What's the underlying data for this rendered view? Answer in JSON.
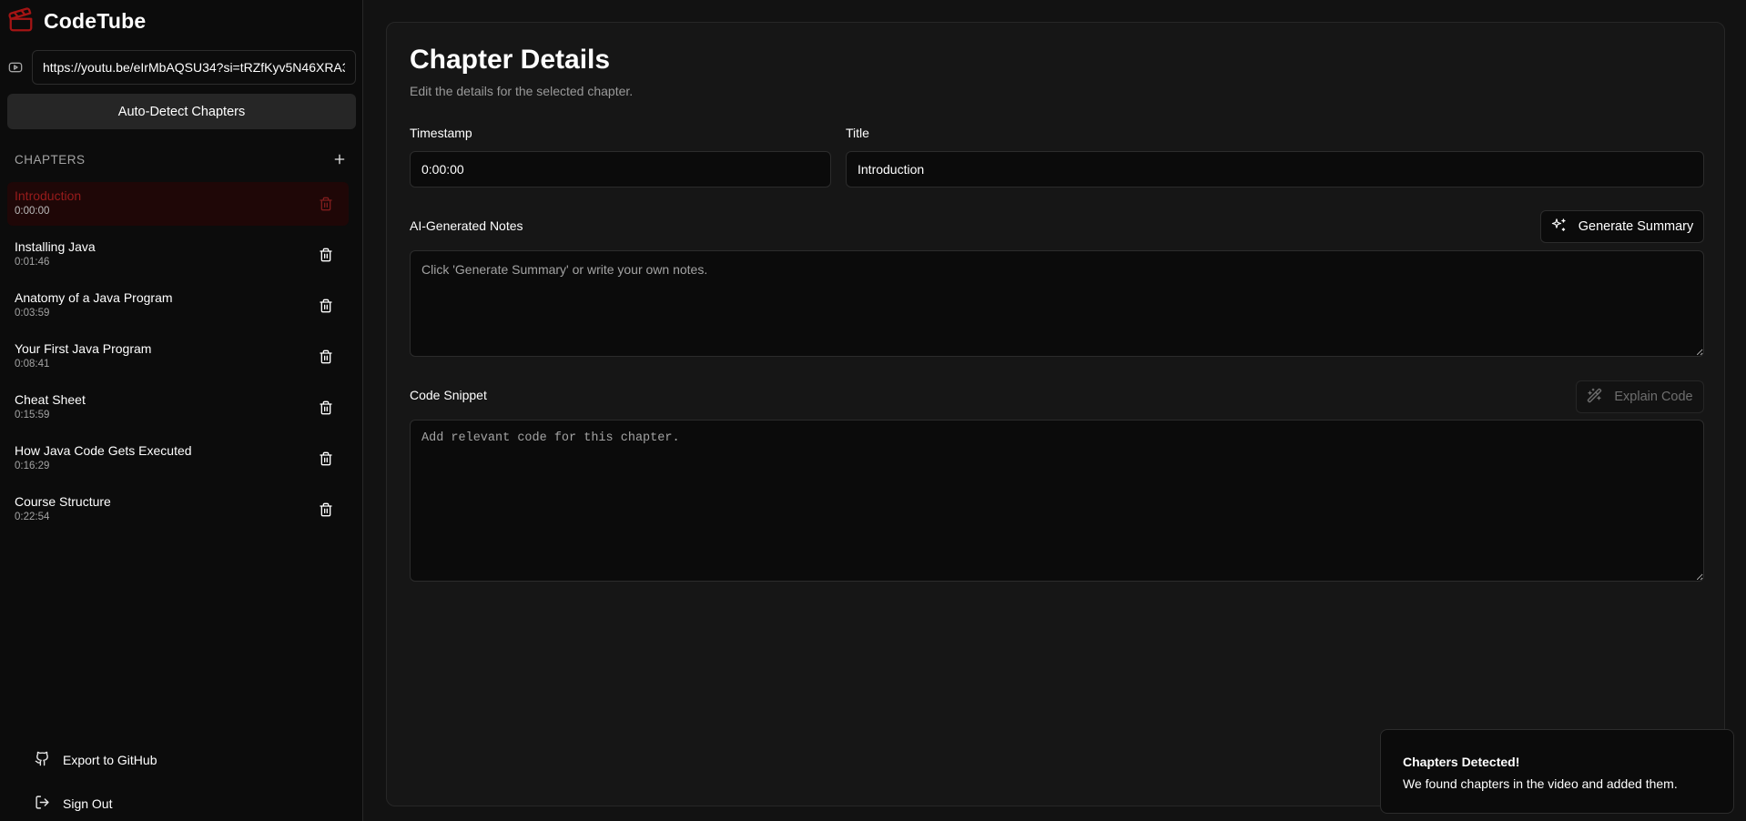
{
  "app": {
    "name": "CodeTube",
    "logo_icon": "clapperboard-icon",
    "brand_color": "#a41414"
  },
  "url_input": {
    "value": "https://youtu.be/eIrMbAQSU34?si=tRZfKyv5N46XRA3",
    "icon": "youtube-icon"
  },
  "auto_detect_label": "Auto-Detect Chapters",
  "chapters_section": {
    "title": "CHAPTERS",
    "items": [
      {
        "title": "Introduction",
        "time": "0:00:00",
        "active": true
      },
      {
        "title": "Installing Java",
        "time": "0:01:46",
        "active": false
      },
      {
        "title": "Anatomy of a Java Program",
        "time": "0:03:59",
        "active": false
      },
      {
        "title": "Your First Java Program",
        "time": "0:08:41",
        "active": false
      },
      {
        "title": "Cheat Sheet",
        "time": "0:15:59",
        "active": false
      },
      {
        "title": "How Java Code Gets Executed",
        "time": "0:16:29",
        "active": false
      },
      {
        "title": "Course Structure",
        "time": "0:22:54",
        "active": false
      }
    ]
  },
  "footer": {
    "export_label": "Export to GitHub",
    "signout_label": "Sign Out"
  },
  "details": {
    "title": "Chapter Details",
    "subtitle": "Edit the details for the selected chapter.",
    "timestamp_label": "Timestamp",
    "timestamp_value": "0:00:00",
    "title_label": "Title",
    "title_value": "Introduction",
    "notes_label": "AI-Generated Notes",
    "notes_placeholder": "Click 'Generate Summary' or write your own notes.",
    "generate_summary_label": "Generate Summary",
    "code_label": "Code Snippet",
    "code_placeholder": "Add relevant code for this chapter.",
    "explain_code_label": "Explain Code"
  },
  "toast": {
    "title": "Chapters Detected!",
    "description": "We found chapters in the video and added them."
  }
}
